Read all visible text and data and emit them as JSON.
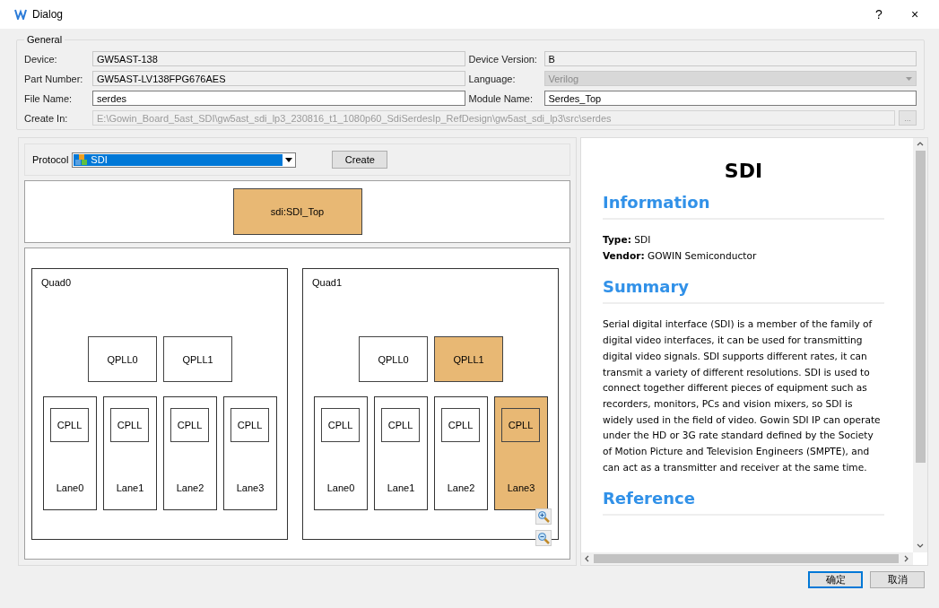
{
  "window": {
    "title": "Dialog",
    "help": "?",
    "close": "×"
  },
  "general": {
    "title": "General",
    "fields": [
      {
        "label": "Device:",
        "value": "GW5AST-138",
        "kind": "readonly"
      },
      {
        "label": "Device Version:",
        "value": "B",
        "kind": "readonly"
      },
      {
        "label": "Part Number:",
        "value": "GW5AST-LV138FPG676AES",
        "kind": "readonly"
      },
      {
        "label": "Language:",
        "value": "Verilog",
        "kind": "combo"
      },
      {
        "label": "File Name:",
        "value": "serdes",
        "kind": "edit"
      },
      {
        "label": "Module Name:",
        "value": "Serdes_Top",
        "kind": "edit"
      }
    ],
    "create_in": {
      "label": "Create In:",
      "value": "E:\\Gowin_Board_5ast_SDI\\gw5ast_sdi_lp3_230816_t1_1080p60_SdiSerdesIp_RefDesign\\gw5ast_sdi_lp3\\src\\serdes",
      "browse": "..."
    }
  },
  "protocol": {
    "label": "Protocol",
    "value": "SDI",
    "create": "Create"
  },
  "top_block": {
    "label": "sdi:SDI_Top",
    "selected": true
  },
  "quads": [
    {
      "label": "Quad0",
      "qplls": [
        {
          "label": "QPLL0",
          "selected": false
        },
        {
          "label": "QPLL1",
          "selected": false
        }
      ],
      "lanes": [
        {
          "label": "Lane0",
          "cpll": "CPLL",
          "selected": false
        },
        {
          "label": "Lane1",
          "cpll": "CPLL",
          "selected": false
        },
        {
          "label": "Lane2",
          "cpll": "CPLL",
          "selected": false
        },
        {
          "label": "Lane3",
          "cpll": "CPLL",
          "selected": false
        }
      ]
    },
    {
      "label": "Quad1",
      "qplls": [
        {
          "label": "QPLL0",
          "selected": false
        },
        {
          "label": "QPLL1",
          "selected": true
        }
      ],
      "lanes": [
        {
          "label": "Lane0",
          "cpll": "CPLL",
          "selected": false
        },
        {
          "label": "Lane1",
          "cpll": "CPLL",
          "selected": false
        },
        {
          "label": "Lane2",
          "cpll": "CPLL",
          "selected": false
        },
        {
          "label": "Lane3",
          "cpll": "CPLL",
          "selected": true
        }
      ]
    }
  ],
  "doc": {
    "title": "SDI",
    "sections": [
      {
        "heading": "Information",
        "lines": [
          "**Type:** SDI",
          "**Vendor:** GOWIN Semiconductor"
        ]
      },
      {
        "heading": "Summary",
        "lines": [
          "Serial digital interface (SDI) is a member of the family of digital video interfaces, it can be used for transmitting digital video signals. SDI supports different rates, it can transmit a variety of different resolutions. SDI is used to connect together different pieces of equipment such as recorders, monitors, PCs and vision mixers, so SDI is widely used in the field of video. Gowin SDI IP can operate under the HD or 3G rate standard defined by the Society of Motion Picture and Television Engineers (SMPTE), and can act as a transmitter and receiver at the same time."
        ]
      },
      {
        "heading": "Reference"
      }
    ]
  },
  "buttons": [
    {
      "label": "确定",
      "default": true
    },
    {
      "label": "取消",
      "default": false
    }
  ]
}
